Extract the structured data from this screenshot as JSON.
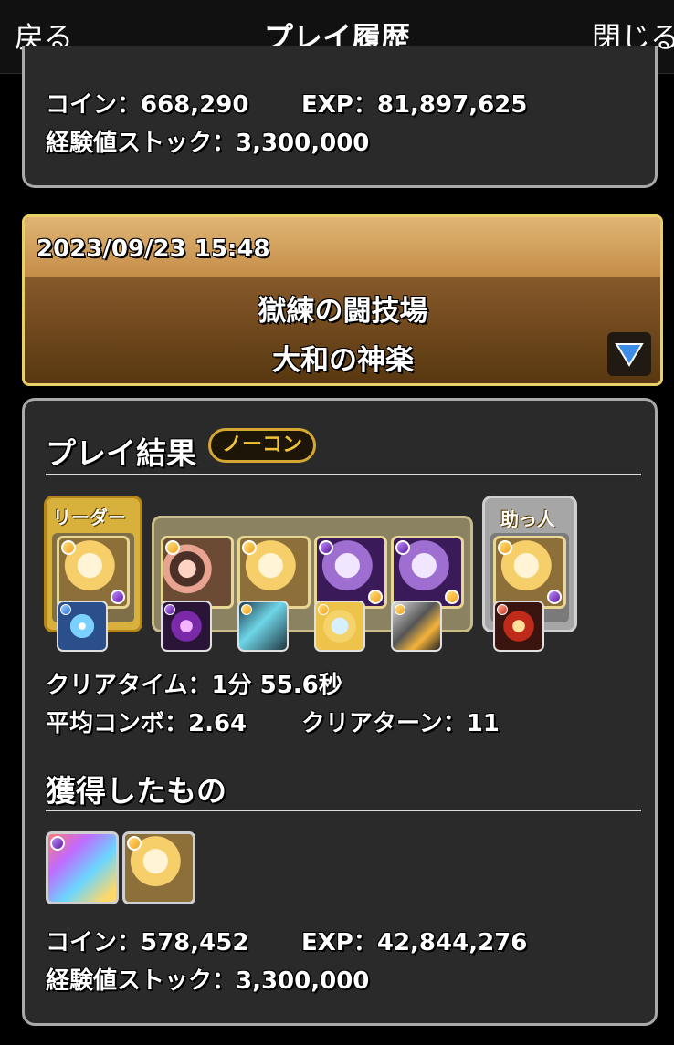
{
  "header": {
    "back_label": "戻る",
    "title": "プレイ履歴",
    "close_label": "閉じる"
  },
  "previous_entry": {
    "coin": "コイン：668,290",
    "exp": "EXP：81,897,625",
    "exp_stock": "経験値ストック：3,300,000"
  },
  "entry": {
    "datetime": "2023/09/23 15:48",
    "dungeon": "獄練の闘技場",
    "floor": "大和の神楽",
    "result": {
      "title": "プレイ結果",
      "badge": "ノーコン",
      "leader_label": "リーダー",
      "helper_label": "助っ人",
      "team": [
        {
          "role": "leader",
          "attribute": "light",
          "portrait": "blonde-girl-portrait",
          "assist": "crystal-weapon"
        },
        {
          "role": "sub",
          "attribute": "light",
          "portrait": "family-group-portrait",
          "assist": "purple-crystal"
        },
        {
          "role": "sub",
          "attribute": "light",
          "portrait": "blonde-girl-portrait",
          "assist": "mech-armor"
        },
        {
          "role": "sub",
          "attribute": "dark",
          "portrait": "dark-girl-portrait",
          "assist": "golden-coin"
        },
        {
          "role": "sub",
          "attribute": "dark",
          "portrait": "dark-girl-portrait",
          "assist": "shovel-weapon"
        },
        {
          "role": "helper",
          "attribute": "light",
          "portrait": "blonde-girl-portrait",
          "assist": "fire-ring"
        }
      ],
      "clear_time": "クリアタイム：1分 55.6秒",
      "avg_combo": "平均コンボ：2.64",
      "clear_turns": "クリアターン：11"
    },
    "rewards": {
      "title": "獲得したもの",
      "items": [
        {
          "attribute": "dark",
          "portrait": "rainbow-dragon-portrait"
        },
        {
          "attribute": "light",
          "portrait": "golden-knight-portrait"
        }
      ],
      "coin": "コイン：578,452",
      "exp": "EXP：42,844,276",
      "exp_stock": "経験値ストック：3,300,000"
    }
  },
  "colors": {
    "accent_gold": "#e9cf68",
    "date_bar": "#d4a25e",
    "badge_text": "#f2c33a",
    "panel_bg": "#2a2a2a",
    "panel_border": "#a9a9a9"
  }
}
